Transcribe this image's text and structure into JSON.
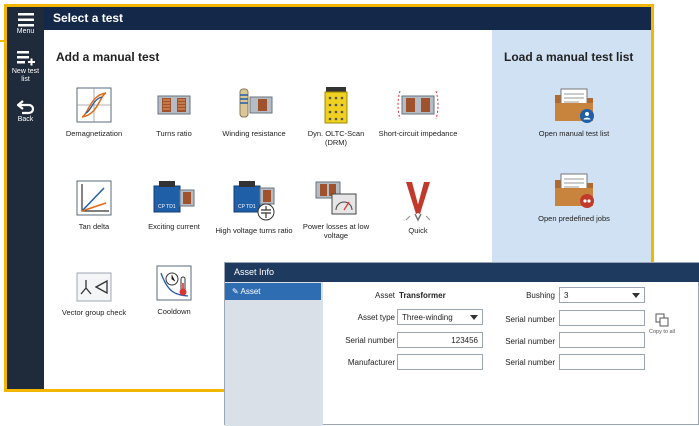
{
  "rail": {
    "menu_label": "Menu",
    "new_list_label": "New test list",
    "back_label": "Back"
  },
  "header": {
    "title": "Select a test"
  },
  "manual_test": {
    "heading": "Add a manual test",
    "tiles": [
      {
        "label": "Demagnetization",
        "icon": "demagnetization-icon"
      },
      {
        "label": "Turns ratio",
        "icon": "turns-ratio-icon"
      },
      {
        "label": "Winding resistance",
        "icon": "winding-resistance-icon"
      },
      {
        "label": "Dyn. OLTC-Scan (DRM)",
        "icon": "oltc-scan-icon"
      },
      {
        "label": "Short-circuit impedance",
        "icon": "short-circuit-icon"
      },
      {
        "label": "Tan delta",
        "icon": "tan-delta-icon"
      },
      {
        "label": "Exciting current",
        "icon": "exciting-current-icon"
      },
      {
        "label": "High voltage turns ratio",
        "icon": "hv-turns-ratio-icon"
      },
      {
        "label": "Power losses at low voltage",
        "icon": "power-losses-icon"
      },
      {
        "label": "Quick",
        "icon": "quick-icon"
      },
      {
        "label": "Vector group check",
        "icon": "vector-group-icon"
      },
      {
        "label": "Cooldown",
        "icon": "cooldown-icon"
      }
    ]
  },
  "load_list": {
    "heading": "Load a manual test list",
    "items": [
      {
        "label": "Open manual test list",
        "icon": "folder-user-icon"
      },
      {
        "label": "Open predefined jobs",
        "icon": "folder-jobs-icon"
      }
    ]
  },
  "asset_info": {
    "title": "Asset Info",
    "sidebar_item": "Asset",
    "asset_label": "Asset",
    "asset_value": "Transformer",
    "asset_type_label": "Asset type",
    "asset_type_value": "Three-winding",
    "serial_label": "Serial number",
    "serial_value": "123456",
    "manufacturer_label": "Manufacturer",
    "manufacturer_value": "",
    "bushing_label": "Bushing",
    "bushing_value": "3",
    "bushing_serial_label": "Serial number",
    "copy_label": "Copy to all"
  },
  "colors": {
    "accent": "#f2b600",
    "rail": "#1f2a3a",
    "header": "#14294a",
    "panel": "#cfe1f2",
    "selected": "#2f6db3"
  }
}
